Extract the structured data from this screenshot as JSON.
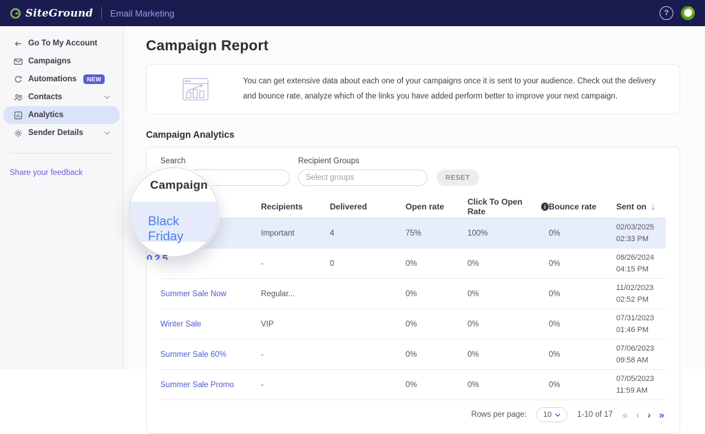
{
  "colors": {
    "topbar": "#1a1c50",
    "accent_link": "#515bce",
    "row_highlight": "#e7edfb",
    "badge": "#5a5fd6",
    "lens_link": "#4a80e8",
    "brand_green": "#8cc63e"
  },
  "header": {
    "brand": "SiteGround",
    "app_title": "Email Marketing",
    "help_glyph": "?"
  },
  "sidebar": {
    "items": [
      {
        "label": "Go To My Account"
      },
      {
        "label": "Campaigns"
      },
      {
        "label": "Automations",
        "badge": "NEW"
      },
      {
        "label": "Contacts"
      },
      {
        "label": "Analytics"
      },
      {
        "label": "Sender Details"
      }
    ],
    "feedback_link": "Share your feedback"
  },
  "main": {
    "page_title": "Campaign Report",
    "info_text": "You can get extensive data about each one of your campaigns once it is sent to your audience. Check out the delivery and bounce rate, analyze which of the links you have added perform better to improve your next campaign.",
    "section_title": "Campaign Analytics",
    "filters": {
      "search_label": "Search",
      "recipient_groups_label": "Recipient Groups",
      "recipient_groups_placeholder": "Select groups",
      "reset_label": "RESET"
    },
    "table": {
      "columns": [
        "Campaign",
        "Recipients",
        "Delivered",
        "Open rate",
        "Click To Open Rate",
        "Bounce rate",
        "Sent on"
      ],
      "rows": [
        {
          "campaign": "Black Friday",
          "recipients": "Important",
          "delivered": "4",
          "open_rate": "75%",
          "click_to_open_rate": "100%",
          "bounce_rate": "0%",
          "sent_on": "02/03/2025 02:33 PM"
        },
        {
          "campaign": "",
          "recipients": "-",
          "delivered": "0",
          "open_rate": "0%",
          "click_to_open_rate": "0%",
          "bounce_rate": "0%",
          "sent_on": "08/26/2024 04:15 PM"
        },
        {
          "campaign": "Summer Sale Now",
          "recipients": "Regular...",
          "delivered": "",
          "open_rate": "0%",
          "click_to_open_rate": "0%",
          "bounce_rate": "0%",
          "sent_on": "11/02/2023 02:52 PM"
        },
        {
          "campaign": "Winter Sale",
          "recipients": "VIP",
          "delivered": "",
          "open_rate": "0%",
          "click_to_open_rate": "0%",
          "bounce_rate": "0%",
          "sent_on": "07/31/2023 01:46 PM"
        },
        {
          "campaign": "Summer Sale 60%",
          "recipients": "-",
          "delivered": "",
          "open_rate": "0%",
          "click_to_open_rate": "0%",
          "bounce_rate": "0%",
          "sent_on": "07/06/2023 09:58 AM"
        },
        {
          "campaign": "Summer Sale Promo",
          "recipients": "-",
          "delivered": "",
          "open_rate": "0%",
          "click_to_open_rate": "0%",
          "bounce_rate": "0%",
          "sent_on": "07/05/2023 11:59 AM"
        }
      ]
    },
    "pagination": {
      "rows_per_page_label": "Rows per page:",
      "rows_per_page_value": "10",
      "range_text": "1-10 of 17",
      "first": "«",
      "prev": "‹",
      "next": "›",
      "last": "»"
    }
  },
  "lens": {
    "header_text": "Campaign",
    "row_text": "Black Friday",
    "edge_fragment": "025"
  }
}
